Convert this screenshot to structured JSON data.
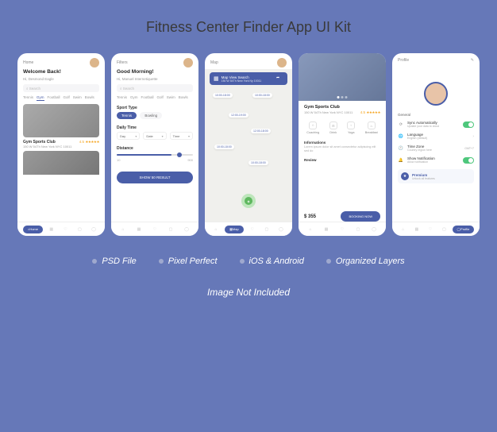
{
  "title": "Fitness Center Finder App UI Kit",
  "features": [
    "PSD File",
    "Pixel Perfect",
    "iOS & Android",
    "Organized Layers"
  ],
  "note": "Image Not Included",
  "screen1": {
    "header_label": "Home",
    "greeting": "Welcome Back!",
    "subtitle": "Hi, Desmond Eagle",
    "search_placeholder": "Search",
    "tabs": [
      "Tennis",
      "Gym",
      "Football",
      "Golf",
      "Swim",
      "Bowls"
    ],
    "active_tab": "Gym",
    "card_title": "Gym Sports Club",
    "card_address": "150 W 54Th New York NYC 10011",
    "rating": "4.5",
    "nav_active": "Home"
  },
  "screen2": {
    "header_label": "Filters",
    "greeting": "Good Morning!",
    "subtitle": "Hi, Manuel Internetiquette",
    "search_placeholder": "Search",
    "tabs": [
      "Tennis",
      "Gym",
      "Football",
      "Golf",
      "Swim",
      "Bowls"
    ],
    "sport_type_label": "Sport Type",
    "sport_options": [
      "Tennis",
      "Bowling"
    ],
    "daily_time_label": "Daily Time",
    "day_value": "Day",
    "date_value": "Date",
    "time_value": "Time",
    "distance_label": "Distance",
    "distance_min": "10",
    "distance_max": "900",
    "btn_label": "SHOW 50 RESULT"
  },
  "screen3": {
    "header_label": "Map",
    "map_title": "Map View Search",
    "map_address": "150 W 54Th New York Ny 10011",
    "chips": [
      "10:00-18:00",
      "10:00-18:00",
      "12:00-19:00",
      "12:00-18:00",
      "10:00-18:00",
      "10:00-18:00"
    ],
    "nav_active": "Map"
  },
  "screen4": {
    "detail_name": "Gym Sports Club",
    "detail_address": "150 W 54Th New York NYC 10011",
    "rating": "4.5",
    "amenities": [
      "Coaching",
      "Drink",
      "Yoga",
      "Breakfast"
    ],
    "info_label": "Informations",
    "info_text": "Lorem ipsum dolor sit amet consectetur adipiscing elit sed do",
    "review_label": "Review",
    "price": "$ 355",
    "btn_label": "BOOKING NOW"
  },
  "screen5": {
    "header_label": "Profile",
    "section_label": "General",
    "settings": [
      {
        "title": "Sync Automatically",
        "sub": "Update your data to cloud",
        "toggle": true
      },
      {
        "title": "Language",
        "sub": "English (default)",
        "chevron": true
      },
      {
        "title": "Time Zone",
        "sub": "Country region here",
        "sub2": "GMT+7"
      },
      {
        "title": "Show Notification",
        "sub": "Allow notification",
        "toggle": true
      }
    ],
    "premium_title": "Premium",
    "premium_sub": "Unlock all features",
    "nav_active": "Profile"
  }
}
